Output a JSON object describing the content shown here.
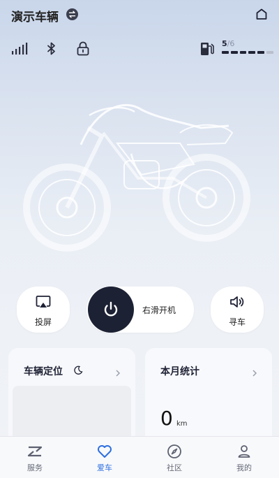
{
  "header": {
    "title": "演示车辆",
    "switch_icon": "swap-icon",
    "home_icon": "home-icon"
  },
  "status": {
    "signal_icon": "signal-bars-icon",
    "bluetooth_icon": "bluetooth-icon",
    "lock_icon": "lock-icon",
    "fuel_icon": "fuel-pump-icon",
    "fuel_level": "5",
    "fuel_total": "/6",
    "fuel_fraction": 0.8333
  },
  "controls": {
    "cast_label": "投屏",
    "slide_label": "右滑开机",
    "find_label": "寻车"
  },
  "cards": {
    "location_title": "车辆定位",
    "stats_title": "本月统计",
    "stats_value": "0",
    "stats_unit": "km"
  },
  "tabs": [
    {
      "label": "服务",
      "icon": "service-icon"
    },
    {
      "label": "爱车",
      "icon": "heart-icon"
    },
    {
      "label": "社区",
      "icon": "compass-icon"
    },
    {
      "label": "我的",
      "icon": "person-icon"
    }
  ],
  "colors": {
    "accent": "#2d6fe0",
    "dark": "#1d2134"
  }
}
